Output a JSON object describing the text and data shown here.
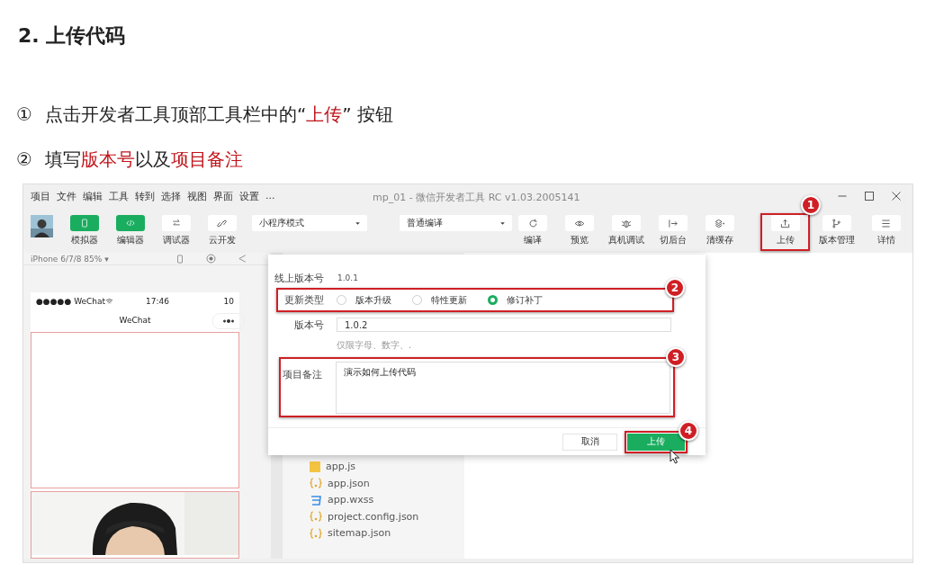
{
  "heading": "2. 上传代码",
  "steps": [
    {
      "marker": "①",
      "text": "点击开发者工具顶部工具栏中的“**上传**” 按钮"
    },
    {
      "marker": "②",
      "text": "填写**版本号**以及**项目备注**"
    }
  ],
  "screen": {
    "menu": [
      "项目",
      "文件",
      "编辑",
      "工具",
      "转到",
      "选择",
      "视图",
      "界面",
      "设置",
      "..."
    ],
    "title": "mp_01 - 微信开发者工具 RC v1.03.2005141",
    "left_tools": [
      {
        "label": "模拟器",
        "active": true
      },
      {
        "label": "编辑器",
        "active": true
      },
      {
        "label": "调试器",
        "active": false
      },
      {
        "label": "云开发",
        "active": false
      }
    ],
    "mode_select": {
      "value": "小程序模式"
    },
    "compile_select": {
      "value": "普通编译"
    },
    "compile_tools": [
      {
        "label": "编译"
      },
      {
        "label": "预览"
      },
      {
        "label": "真机调试"
      },
      {
        "label": "切后台"
      },
      {
        "label": "清缓存"
      }
    ],
    "right_tools": [
      {
        "label": "上传",
        "callout": "1"
      },
      {
        "label": "版本管理"
      },
      {
        "label": "详情"
      }
    ],
    "simulator": {
      "device": "iPhone 6/7/8 85% ▾",
      "carrier": "●●●●● WeChat",
      "time": "17:46",
      "battery": "10",
      "nav_title": "WeChat"
    },
    "files": [
      {
        "name": "app.js",
        "kind": "js"
      },
      {
        "name": "app.json",
        "kind": "json"
      },
      {
        "name": "app.wxss",
        "kind": "wxss"
      },
      {
        "name": "project.config.json",
        "kind": "json"
      },
      {
        "name": "sitemap.json",
        "kind": "json"
      }
    ],
    "dialog": {
      "online_version_label": "线上版本号",
      "online_version": "1.0.1",
      "update_type": {
        "label": "更新类型",
        "callout": "2",
        "options": [
          {
            "label": "版本升级",
            "selected": false
          },
          {
            "label": "特性更新",
            "selected": false
          },
          {
            "label": "修订补丁",
            "selected": true
          }
        ]
      },
      "version": {
        "label": "版本号",
        "value": "1.0.2",
        "hint": "仅限字母、数字、."
      },
      "remark": {
        "label": "项目备注",
        "value": "演示如何上传代码",
        "callout": "3"
      },
      "buttons": [
        {
          "label": "取消",
          "kind": "secondary"
        },
        {
          "label": "上传",
          "kind": "primary",
          "callout": "4"
        }
      ]
    }
  }
}
